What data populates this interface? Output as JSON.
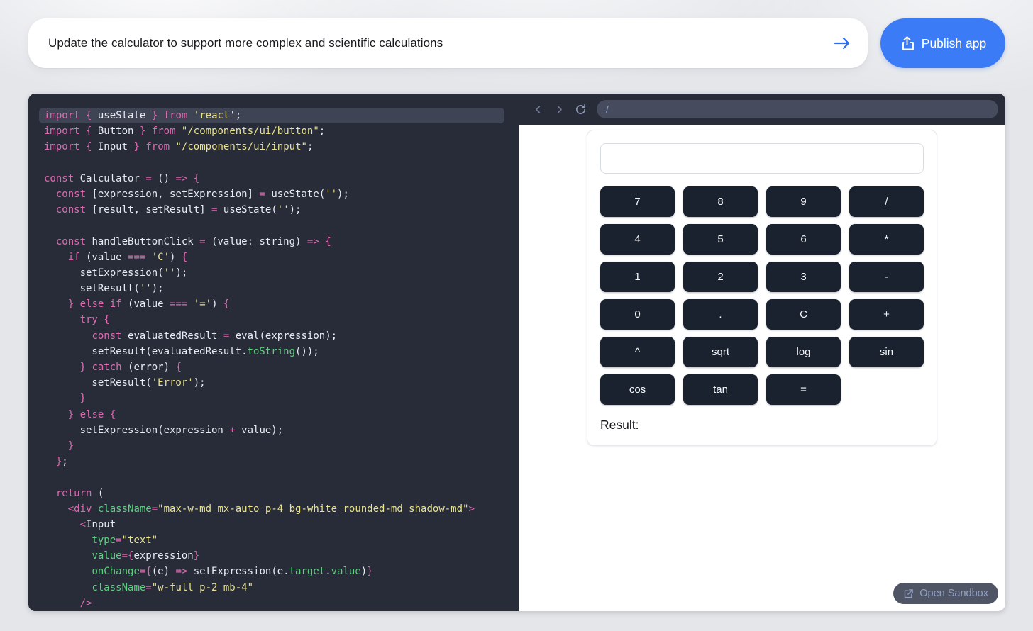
{
  "prompt_bar": {
    "text": "Update the calculator to support more complex and scientific calculations",
    "submit_icon": "arrow-right-icon",
    "arrow_color": "#2b6cf0"
  },
  "publish": {
    "label": "Publish app",
    "icon": "share-icon",
    "color": "#3c7bf6"
  },
  "editor": {
    "bg": "#272c38",
    "highlight_bg": "#3e4454",
    "token_colors": {
      "keyword": "#de6bb2",
      "plain": "#e9ecf3",
      "string": "#e9e28f",
      "property": "#5ed17f"
    },
    "lines": [
      {
        "hl": true,
        "t": [
          [
            "k",
            "import"
          ],
          [
            "w",
            " "
          ],
          [
            "k",
            "{"
          ],
          [
            "w",
            " useState "
          ],
          [
            "k",
            "}"
          ],
          [
            "w",
            " "
          ],
          [
            "k",
            "from"
          ],
          [
            "w",
            " "
          ],
          [
            "s",
            "'react'"
          ],
          [
            "w",
            ";"
          ]
        ]
      },
      {
        "t": [
          [
            "k",
            "import"
          ],
          [
            "w",
            " "
          ],
          [
            "k",
            "{"
          ],
          [
            "w",
            " Button "
          ],
          [
            "k",
            "}"
          ],
          [
            "w",
            " "
          ],
          [
            "k",
            "from"
          ],
          [
            "w",
            " "
          ],
          [
            "s",
            "\"/components/ui/button\""
          ],
          [
            "w",
            ";"
          ]
        ]
      },
      {
        "t": [
          [
            "k",
            "import"
          ],
          [
            "w",
            " "
          ],
          [
            "k",
            "{"
          ],
          [
            "w",
            " Input "
          ],
          [
            "k",
            "}"
          ],
          [
            "w",
            " "
          ],
          [
            "k",
            "from"
          ],
          [
            "w",
            " "
          ],
          [
            "s",
            "\"/components/ui/input\""
          ],
          [
            "w",
            ";"
          ]
        ]
      },
      {
        "t": []
      },
      {
        "t": [
          [
            "k",
            "const"
          ],
          [
            "w",
            " Calculator "
          ],
          [
            "k",
            "="
          ],
          [
            "w",
            " () "
          ],
          [
            "k",
            "=>"
          ],
          [
            "w",
            " "
          ],
          [
            "k",
            "{"
          ]
        ]
      },
      {
        "t": [
          [
            "w",
            "  "
          ],
          [
            "k",
            "const"
          ],
          [
            "w",
            " [expression, setExpression] "
          ],
          [
            "k",
            "="
          ],
          [
            "w",
            " useState("
          ],
          [
            "s",
            "''"
          ],
          [
            "w",
            ");"
          ]
        ]
      },
      {
        "t": [
          [
            "w",
            "  "
          ],
          [
            "k",
            "const"
          ],
          [
            "w",
            " [result, setResult] "
          ],
          [
            "k",
            "="
          ],
          [
            "w",
            " useState("
          ],
          [
            "s",
            "''"
          ],
          [
            "w",
            ");"
          ]
        ]
      },
      {
        "t": []
      },
      {
        "t": [
          [
            "w",
            "  "
          ],
          [
            "k",
            "const"
          ],
          [
            "w",
            " handleButtonClick "
          ],
          [
            "k",
            "="
          ],
          [
            "w",
            " (value: string) "
          ],
          [
            "k",
            "=>"
          ],
          [
            "w",
            " "
          ],
          [
            "k",
            "{"
          ]
        ]
      },
      {
        "t": [
          [
            "w",
            "    "
          ],
          [
            "k",
            "if"
          ],
          [
            "w",
            " (value "
          ],
          [
            "k",
            "==="
          ],
          [
            "w",
            " "
          ],
          [
            "s",
            "'C'"
          ],
          [
            "w",
            ") "
          ],
          [
            "k",
            "{"
          ]
        ]
      },
      {
        "t": [
          [
            "w",
            "      setExpression("
          ],
          [
            "s",
            "''"
          ],
          [
            "w",
            ");"
          ]
        ]
      },
      {
        "t": [
          [
            "w",
            "      setResult("
          ],
          [
            "s",
            "''"
          ],
          [
            "w",
            ");"
          ]
        ]
      },
      {
        "t": [
          [
            "w",
            "    "
          ],
          [
            "k",
            "}"
          ],
          [
            "w",
            " "
          ],
          [
            "k",
            "else"
          ],
          [
            "w",
            " "
          ],
          [
            "k",
            "if"
          ],
          [
            "w",
            " (value "
          ],
          [
            "k",
            "==="
          ],
          [
            "w",
            " "
          ],
          [
            "s",
            "'='"
          ],
          [
            "w",
            ") "
          ],
          [
            "k",
            "{"
          ]
        ]
      },
      {
        "t": [
          [
            "w",
            "      "
          ],
          [
            "k",
            "try"
          ],
          [
            "w",
            " "
          ],
          [
            "k",
            "{"
          ]
        ]
      },
      {
        "t": [
          [
            "w",
            "        "
          ],
          [
            "k",
            "const"
          ],
          [
            "w",
            " evaluatedResult "
          ],
          [
            "k",
            "="
          ],
          [
            "w",
            " eval(expression);"
          ]
        ]
      },
      {
        "t": [
          [
            "w",
            "        setResult(evaluatedResult."
          ],
          [
            "g",
            "toString"
          ],
          [
            "w",
            "());"
          ]
        ]
      },
      {
        "t": [
          [
            "w",
            "      "
          ],
          [
            "k",
            "}"
          ],
          [
            "w",
            " "
          ],
          [
            "k",
            "catch"
          ],
          [
            "w",
            " (error) "
          ],
          [
            "k",
            "{"
          ]
        ]
      },
      {
        "t": [
          [
            "w",
            "        setResult("
          ],
          [
            "s",
            "'Error'"
          ],
          [
            "w",
            ");"
          ]
        ]
      },
      {
        "t": [
          [
            "w",
            "      "
          ],
          [
            "k",
            "}"
          ]
        ]
      },
      {
        "t": [
          [
            "w",
            "    "
          ],
          [
            "k",
            "}"
          ],
          [
            "w",
            " "
          ],
          [
            "k",
            "else"
          ],
          [
            "w",
            " "
          ],
          [
            "k",
            "{"
          ]
        ]
      },
      {
        "t": [
          [
            "w",
            "      setExpression(expression "
          ],
          [
            "k",
            "+"
          ],
          [
            "w",
            " value);"
          ]
        ]
      },
      {
        "t": [
          [
            "w",
            "    "
          ],
          [
            "k",
            "}"
          ]
        ]
      },
      {
        "t": [
          [
            "w",
            "  "
          ],
          [
            "k",
            "}"
          ],
          [
            "w",
            ";"
          ]
        ]
      },
      {
        "t": []
      },
      {
        "t": [
          [
            "w",
            "  "
          ],
          [
            "k",
            "return"
          ],
          [
            "w",
            " ("
          ]
        ]
      },
      {
        "t": [
          [
            "w",
            "    "
          ],
          [
            "k",
            "<div"
          ],
          [
            "w",
            " "
          ],
          [
            "g",
            "className"
          ],
          [
            "k",
            "="
          ],
          [
            "s",
            "\"max-w-md mx-auto p-4 bg-white rounded-md shadow-md\""
          ],
          [
            "k",
            ">"
          ]
        ]
      },
      {
        "t": [
          [
            "w",
            "      "
          ],
          [
            "k",
            "<"
          ],
          [
            "w",
            "Input"
          ]
        ]
      },
      {
        "t": [
          [
            "w",
            "        "
          ],
          [
            "g",
            "type"
          ],
          [
            "k",
            "="
          ],
          [
            "s",
            "\"text\""
          ]
        ]
      },
      {
        "t": [
          [
            "w",
            "        "
          ],
          [
            "g",
            "value"
          ],
          [
            "k",
            "={"
          ],
          [
            "w",
            "expression"
          ],
          [
            "k",
            "}"
          ]
        ]
      },
      {
        "t": [
          [
            "w",
            "        "
          ],
          [
            "g",
            "onChange"
          ],
          [
            "k",
            "={"
          ],
          [
            "w",
            "(e) "
          ],
          [
            "k",
            "=>"
          ],
          [
            "w",
            " setExpression(e."
          ],
          [
            "g",
            "target"
          ],
          [
            "w",
            "."
          ],
          [
            "g",
            "value"
          ],
          [
            "w",
            ")"
          ],
          [
            "k",
            "}"
          ]
        ]
      },
      {
        "t": [
          [
            "w",
            "        "
          ],
          [
            "g",
            "className"
          ],
          [
            "k",
            "="
          ],
          [
            "s",
            "\"w-full p-2 mb-4\""
          ]
        ]
      },
      {
        "t": [
          [
            "w",
            "      "
          ],
          [
            "k",
            "/>"
          ]
        ]
      }
    ]
  },
  "preview": {
    "toolbar": {
      "icons": [
        "back-icon",
        "forward-icon",
        "refresh-icon"
      ],
      "url": "/"
    },
    "calculator": {
      "input_value": "",
      "buttons": [
        "7",
        "8",
        "9",
        "/",
        "4",
        "5",
        "6",
        "*",
        "1",
        "2",
        "3",
        "-",
        "0",
        ".",
        "C",
        "+",
        "^",
        "sqrt",
        "log",
        "sin",
        "cos",
        "tan",
        "="
      ],
      "button_bg": "#1a2230",
      "result_label": "Result:"
    },
    "open_sandbox": {
      "label": "Open Sandbox",
      "icon": "external-link-icon"
    }
  }
}
